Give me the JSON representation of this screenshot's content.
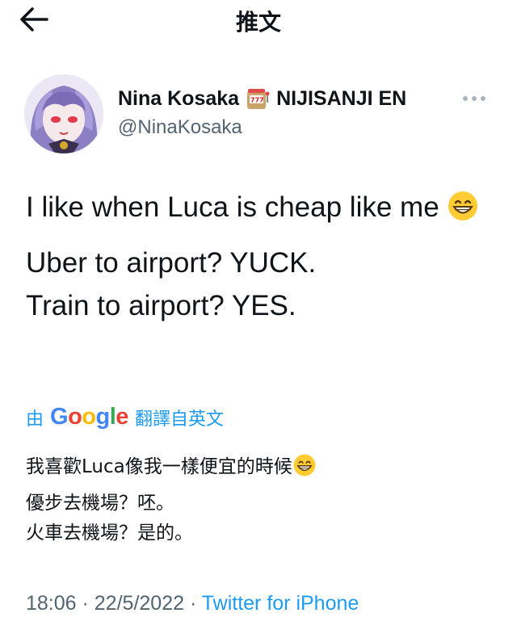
{
  "header": {
    "title": "推文",
    "back_icon": "back-arrow-icon"
  },
  "author": {
    "display_name": "Nina Kosaka",
    "badge_emoji": "slot-machine-icon",
    "affiliation": "NIJISANJI EN",
    "handle": "@NinaKosaka",
    "more_icon": "more-icon"
  },
  "tweet": {
    "para1_text": "I like when Luca is cheap like me",
    "para1_emoji": "grinning-face-icon",
    "line3": "Uber to airport? YUCK.",
    "line4": "Train to airport? YES."
  },
  "translation": {
    "prefix": "由",
    "google": [
      "G",
      "o",
      "o",
      "g",
      "l",
      "e"
    ],
    "suffix": "翻譯自英文",
    "line1": "我喜歡Luca像我一樣便宜的時候",
    "line1_emoji": "grinning-face-icon",
    "line2": "優步去機場？呸。",
    "line3": "火車去機場？是的。"
  },
  "meta": {
    "time": "18:06",
    "separator": " · ",
    "date": "22/5/2022",
    "source": "Twitter for iPhone"
  },
  "colors": {
    "accent": "#1d9bf0",
    "secondary_text": "#536471"
  }
}
